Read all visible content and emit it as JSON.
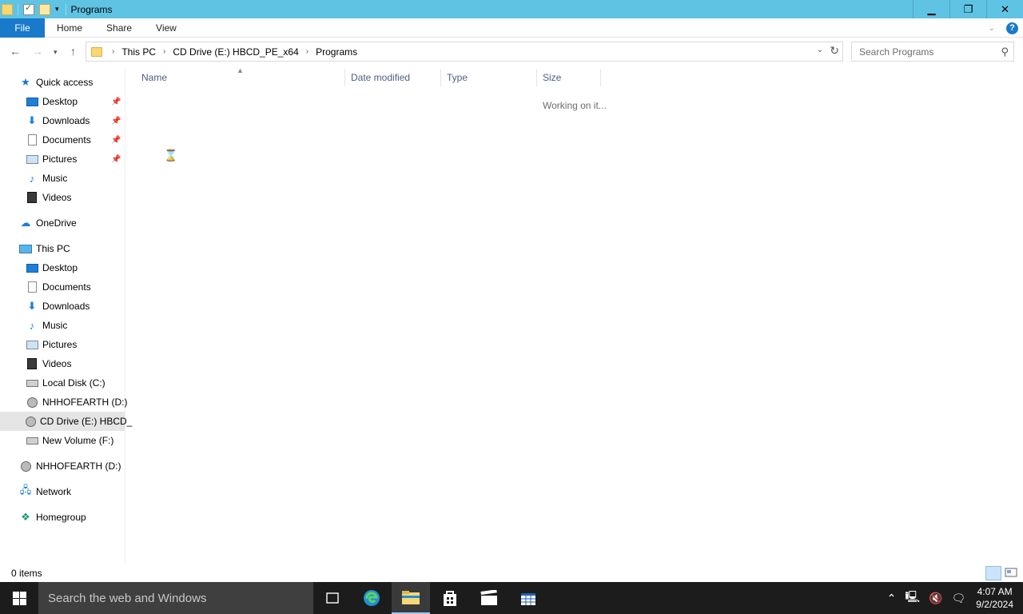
{
  "window": {
    "title": "Programs"
  },
  "ribbon": {
    "tabs": [
      "File",
      "Home",
      "Share",
      "View"
    ]
  },
  "address": {
    "crumbs": [
      "This PC",
      "CD Drive (E:) HBCD_PE_x64",
      "Programs"
    ]
  },
  "search": {
    "placeholder": "Search Programs"
  },
  "navpane": {
    "quick_access": "Quick access",
    "quick_items": [
      "Desktop",
      "Downloads",
      "Documents",
      "Pictures",
      "Music",
      "Videos"
    ],
    "onedrive": "OneDrive",
    "this_pc": "This PC",
    "pc_items": [
      "Desktop",
      "Documents",
      "Downloads",
      "Music",
      "Pictures",
      "Videos",
      "Local Disk (C:)",
      "NHHOFEARTH (D:)",
      "CD Drive (E:) HBCD_",
      "New Volume (F:)"
    ],
    "nhhofearth": "NHHOFEARTH (D:)",
    "network": "Network",
    "homegroup": "Homegroup"
  },
  "columns": [
    "Name",
    "Date modified",
    "Type",
    "Size"
  ],
  "content": {
    "status_message": "Working on it..."
  },
  "statusbar": {
    "item_count": "0 items"
  },
  "taskbar": {
    "search_placeholder": "Search the web and Windows",
    "time": "4:07 AM",
    "date": "9/2/2024"
  },
  "colors": {
    "titlebar": "#5fc3e4",
    "file_tab": "#1979ca",
    "taskbar": "#1c1c1c"
  }
}
